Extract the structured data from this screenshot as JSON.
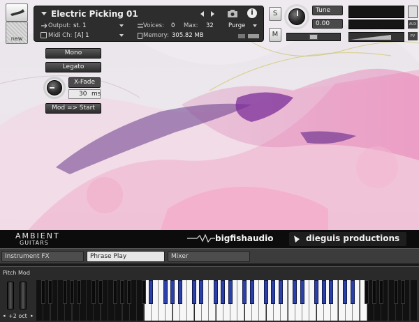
{
  "header": {
    "instrument_name": "Electric Picking 01",
    "output_label": "Output:",
    "output_value": "st. 1",
    "midi_label": "Midi Ch:",
    "midi_value": "[A]  1",
    "voices_label": "Voices:",
    "voices_value": "0",
    "max_label": "Max:",
    "max_value": "32",
    "memory_label": "Memory:",
    "memory_value": "305.82 MB",
    "purge_label": "Purge"
  },
  "tools": {
    "new_label": "new"
  },
  "solo_label": "S",
  "mute_label": "M",
  "tune": {
    "label": "Tune",
    "value": "0.00"
  },
  "side_buttons": [
    "AUX",
    "PV"
  ],
  "controls": {
    "mono_label": "Mono",
    "legato_label": "Legato",
    "xfade_label": "X-Fade",
    "xfade_value": "30",
    "xfade_unit": "ms",
    "mod_start_label": "Mod => Start"
  },
  "brand": {
    "product_line1": "AMBIENT",
    "product_line2": "GUITARS",
    "publisher": "bigfishaudio",
    "developer": "dieguis productions"
  },
  "tabs": [
    "Instrument FX",
    "Phrase Play",
    "Mixer"
  ],
  "active_tab": "Phrase Play",
  "keyboard": {
    "wheels_label": "Pitch Mod",
    "octave_label": "+2 oct"
  },
  "colors": {
    "key_range": "#2a3fa8",
    "panel": "#2d2d2d",
    "brand_bar": "#0c0c0c"
  }
}
